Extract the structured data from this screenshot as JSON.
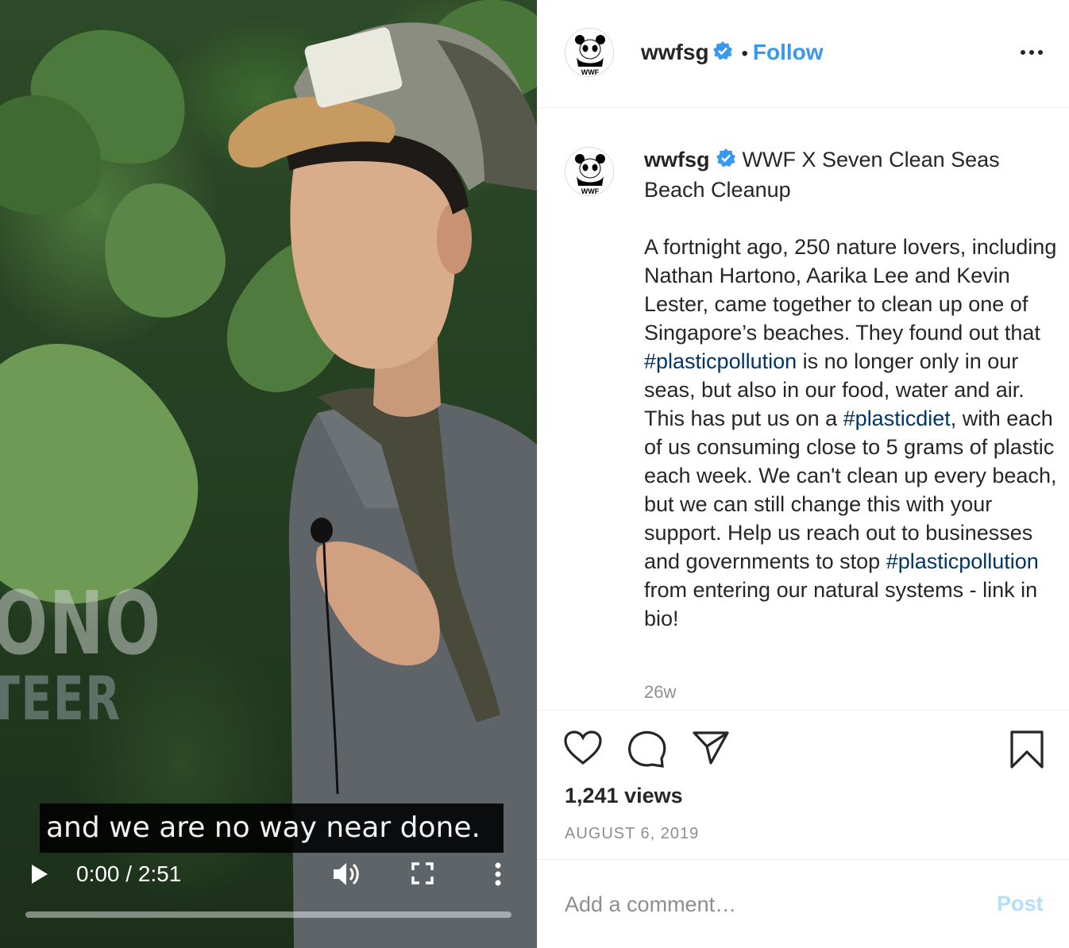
{
  "video": {
    "lower_third_line1": "ONO",
    "lower_third_line2": "TEER",
    "subtitle": "and we are no way near done.",
    "timecode": "0:00 / 2:51",
    "progress": 0
  },
  "header": {
    "username": "wwfsg",
    "separator": "•",
    "follow_label": "Follow",
    "avatar_text": "WWF"
  },
  "caption": {
    "username": "wwfsg",
    "title": "WWF X Seven Clean Seas Beach Cleanup",
    "body_1": "A fortnight ago, 250 nature lovers, including Nathan Hartono, Aarika Lee and Kevin Lester, came together to clean up one of Singapore’s beaches. They found out that ",
    "tag_1": "#plasticpollution",
    "body_2": " is no longer only in our seas, but also in our food, water and air. This has put us on a ",
    "tag_2": "#plasticdiet",
    "body_3": ", with each of us consuming close to 5 grams of plastic each week. We can't clean up every beach, but we can still change this with your support. Help us reach out to businesses and governments to stop ",
    "tag_3": "#plasticpollution",
    "body_4": " from entering our natural systems - link in bio!",
    "age": "26w"
  },
  "stats": {
    "views": "1,241 views",
    "date": "AUGUST 6, 2019"
  },
  "comment": {
    "placeholder": "Add a comment…",
    "post_label": "Post"
  },
  "colors": {
    "link_blue": "#3897f0",
    "hashtag": "#003569",
    "post_disabled": "#b2dffc",
    "muted": "#8e8e8e"
  },
  "icons": [
    "verified-badge-icon",
    "more-options-icon",
    "heart-icon",
    "comment-icon",
    "share-icon",
    "bookmark-icon",
    "play-icon",
    "volume-icon",
    "fullscreen-icon",
    "video-more-icon"
  ]
}
